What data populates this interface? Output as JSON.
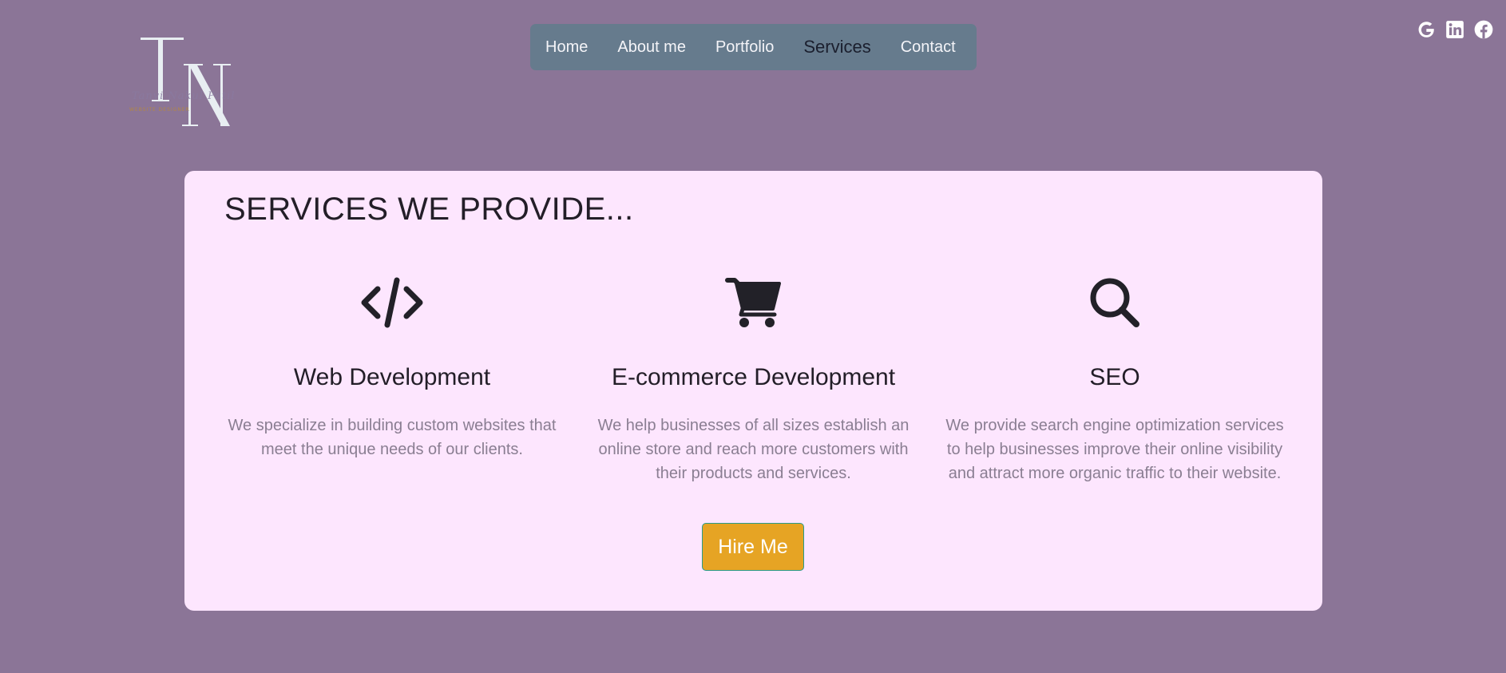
{
  "logo": {
    "monogram": "TN",
    "signature": "Tanvi Nakul Patil",
    "tagline": "WEBSITE DESIGNER"
  },
  "nav": {
    "items": [
      {
        "label": "Home"
      },
      {
        "label": "About me"
      },
      {
        "label": "Portfolio"
      },
      {
        "label": "Services",
        "active": true
      },
      {
        "label": "Contact"
      }
    ]
  },
  "social": {
    "icons": [
      "google-icon",
      "linkedin-icon",
      "facebook-icon"
    ]
  },
  "services_section": {
    "title": "SERVICES WE PROVIDE...",
    "items": [
      {
        "icon": "code-icon",
        "title": "Web Development",
        "description": "We specialize in building custom websites that meet the unique needs of our clients."
      },
      {
        "icon": "shopping-cart-icon",
        "title": "E-commerce Development",
        "description": "We help businesses of all sizes establish an online store and reach more customers with their products and services."
      },
      {
        "icon": "search-icon",
        "title": "SEO",
        "description": "We provide search engine optimization services to help businesses improve their online visibility and attract more organic traffic to their website."
      }
    ],
    "cta_label": "Hire Me"
  },
  "colors": {
    "page_background": "#8b7597",
    "nav_background": "#667b8d",
    "card_background": "#fde6fe",
    "button_background": "#e6a424",
    "icon_color": "#222128"
  }
}
